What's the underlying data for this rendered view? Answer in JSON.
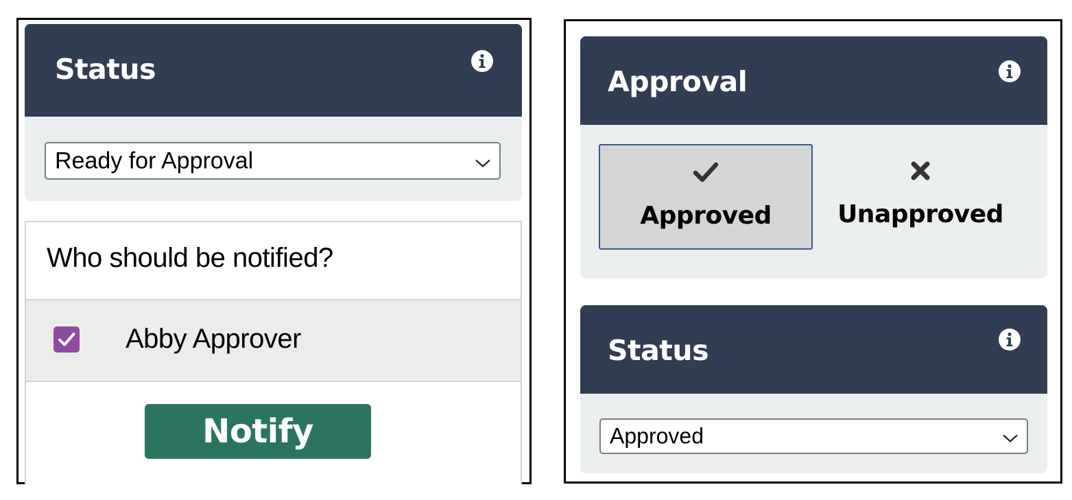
{
  "left_panel": {
    "status_card": {
      "title": "Status",
      "info_icon": "info-circle-icon",
      "select_value": "Ready for Approval"
    },
    "notify": {
      "question": "Who should be notified?",
      "recipients": [
        {
          "name": "Abby Approver",
          "checked": true
        }
      ],
      "button_label": "Notify"
    }
  },
  "right_panel": {
    "approval_card": {
      "title": "Approval",
      "info_icon": "info-circle-icon",
      "options": [
        {
          "label": "Approved",
          "icon": "checkmark-icon",
          "selected": true
        },
        {
          "label": "Unapproved",
          "icon": "x-mark-icon",
          "selected": false
        }
      ]
    },
    "status_card": {
      "title": "Status",
      "info_icon": "info-circle-icon",
      "select_value": "Approved"
    }
  },
  "colors": {
    "header_bg": "#303d52",
    "card_bg": "#ebeeef",
    "notify_button": "#2a7460",
    "checkbox": "#8f4ba0",
    "selected_option_border": "#3b5a8c"
  }
}
